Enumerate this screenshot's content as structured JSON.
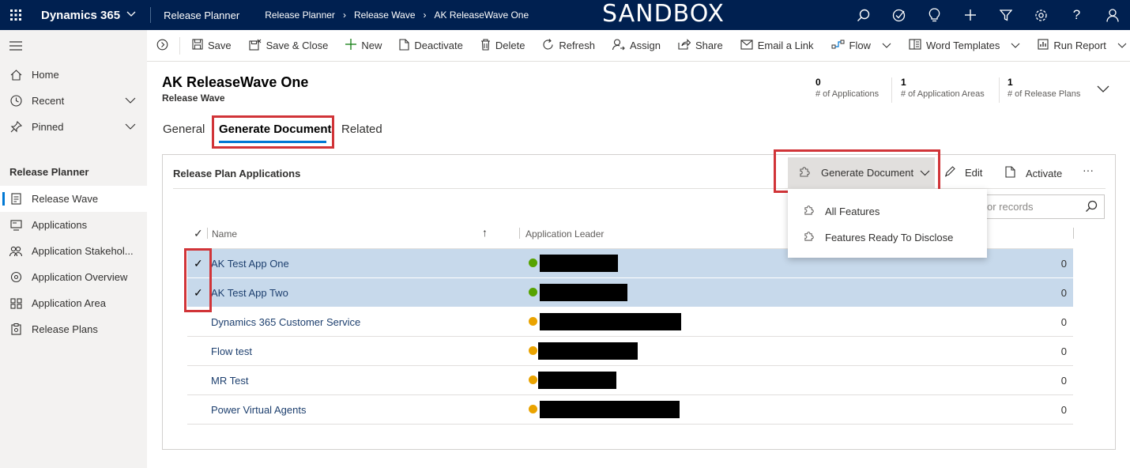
{
  "topbar": {
    "app_name": "Dynamics 365",
    "area": "Release Planner",
    "breadcrumbs": [
      "Release Planner",
      "Release Wave",
      "AK ReleaseWave One"
    ],
    "environment_banner": "SANDBOX",
    "icons": [
      "search-icon",
      "task-icon",
      "lightbulb-icon",
      "plus-icon",
      "filter-icon",
      "settings-icon",
      "help-icon",
      "user-icon"
    ]
  },
  "leftnav": {
    "items": [
      {
        "label": "Home",
        "icon": "home-icon"
      },
      {
        "label": "Recent",
        "icon": "clock-icon"
      },
      {
        "label": "Pinned",
        "icon": "pin-icon"
      }
    ],
    "group_title": "Release Planner",
    "entities": [
      {
        "label": "Release Wave",
        "icon": "document-icon"
      },
      {
        "label": "Applications",
        "icon": "app-icon"
      },
      {
        "label": "Application Stakehol...",
        "icon": "people-icon"
      },
      {
        "label": "Application Overview",
        "icon": "overview-icon"
      },
      {
        "label": "Application Area",
        "icon": "area-icon"
      },
      {
        "label": "Release Plans",
        "icon": "plan-icon"
      }
    ]
  },
  "commandbar": {
    "save": "Save",
    "save_close": "Save & Close",
    "new": "New",
    "deactivate": "Deactivate",
    "delete": "Delete",
    "refresh": "Refresh",
    "assign": "Assign",
    "share": "Share",
    "email_link": "Email a Link",
    "flow": "Flow",
    "word_templates": "Word Templates",
    "run_report": "Run Report"
  },
  "record": {
    "title": "AK ReleaseWave One",
    "entity": "Release Wave",
    "kpis": [
      {
        "value": "0",
        "label": "# of Applications"
      },
      {
        "value": "1",
        "label": "# of Application Areas"
      },
      {
        "value": "1",
        "label": "# of Release Plans"
      }
    ]
  },
  "tabs": [
    "General",
    "Generate Document",
    "Related"
  ],
  "subgrid": {
    "title": "Release Plan Applications",
    "generate_button": "Generate Document",
    "edit": "Edit",
    "activate": "Activate",
    "search_placeholder": "or records",
    "flyout": [
      "All Features",
      "Features Ready To Disclose"
    ],
    "columns": {
      "name": "Name",
      "leader": "Application Leader"
    },
    "rows": [
      {
        "name": "AK Test App One",
        "selected": true,
        "status_color": "#57a300",
        "value": "0"
      },
      {
        "name": "AK Test App Two",
        "selected": true,
        "status_color": "#57a300",
        "value": "0"
      },
      {
        "name": "Dynamics 365 Customer Service",
        "selected": false,
        "status_color": "#eaa300",
        "value": "0"
      },
      {
        "name": "Flow test",
        "selected": false,
        "status_color": "#eaa300",
        "value": "0"
      },
      {
        "name": "MR Test",
        "selected": false,
        "status_color": "#eaa300",
        "value": "0"
      },
      {
        "name": "Power Virtual Agents",
        "selected": false,
        "status_color": "#eaa300",
        "value": "0"
      }
    ]
  },
  "colors": {
    "topbar": "#002050",
    "accent": "#0078d4",
    "highlight": "#d13438",
    "selected_row": "#c7d9eb"
  }
}
